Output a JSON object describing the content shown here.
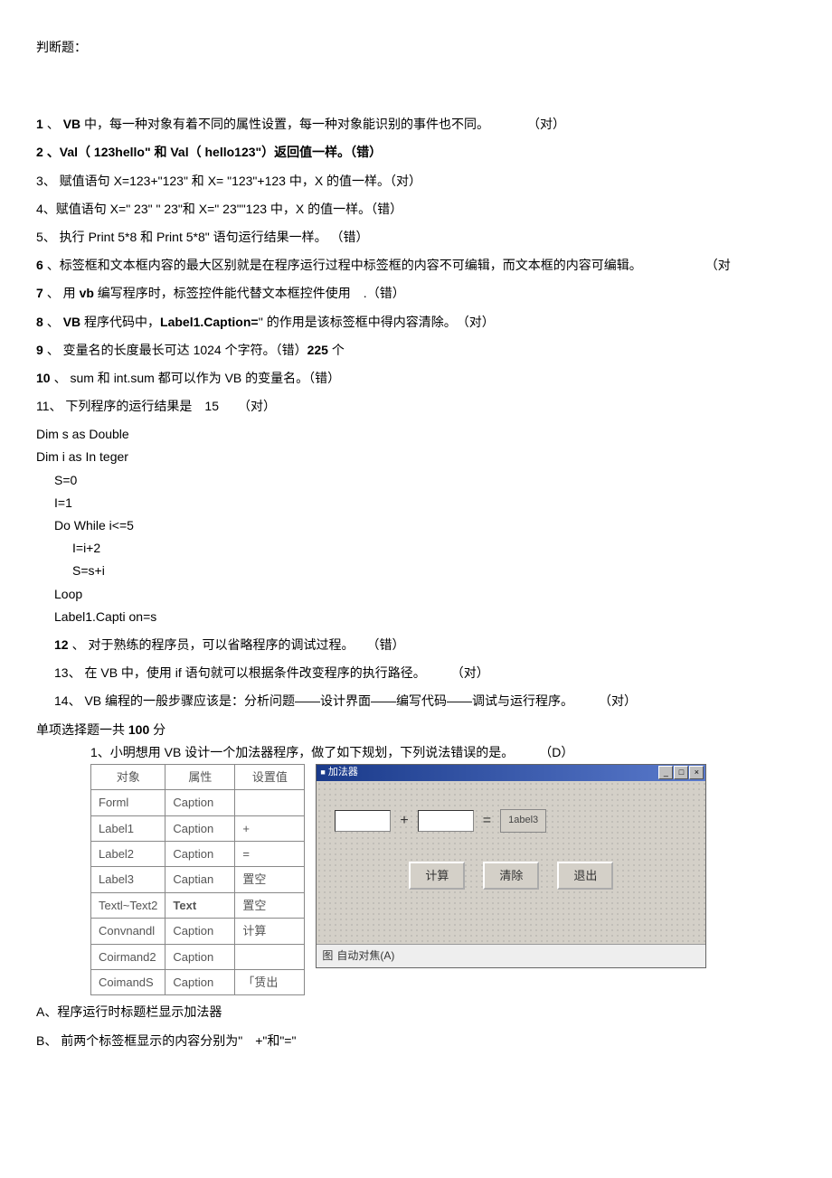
{
  "title": "判断题：",
  "questions": [
    {
      "num": "1",
      "prefix_bold": true,
      "text": "、 <b>VB</b> 中，每一种对象有着不同的属性设置，每一种对象能识别的事件也不同。　　　　（对）"
    },
    {
      "num": "2",
      "prefix_bold": true,
      "bold_all": true,
      "text": "、Val（ 123hello\" 和 Val（ hello123\"）返回值一样。（错）"
    },
    {
      "num": "3",
      "text": "、 赋值语句 X=123+\"123\" 和 X= \"123\"+123 中，X 的值一样。（对）"
    },
    {
      "num": "4",
      "text": "、赋值语句 X=\" 23\" \" 23\"和 X=\" 23\"\"123 中，X 的值一样。（错）"
    },
    {
      "num": "5",
      "text": "、 执行 Print 5*8 和 Print 5*8\" 语句运行结果一样。 （错）"
    },
    {
      "num": "6",
      "prefix_bold": true,
      "text": "、标签框和文本框内容的最大区别就是在程序运行过程中标签框的内容不可编辑，而文本框的内容可编辑。　　　　　　（对"
    },
    {
      "num": "7",
      "prefix_bold": true,
      "text": "、 用 <b>vb</b> 编写程序时，标签控件能代替文本框控件使用　.（错）"
    },
    {
      "num": "8",
      "prefix_bold": true,
      "text": "、 <b>VB</b> 程序代码中，<b>Label1.Caption=</b>'' 的作用是该标签框中得内容清除。　（对）"
    },
    {
      "num": "9",
      "prefix_bold": true,
      "text": "、 变量名的长度最长可达 1024 个字符。（错）<b>225</b> 个"
    },
    {
      "num": "10",
      "prefix_bold": true,
      "text": "、 sum 和 int.sum 都可以作为 VB 的变量名。（错）"
    },
    {
      "num": "11",
      "text": "、 下列程序的运行结果是　15　　（对）"
    }
  ],
  "code": [
    {
      "indent": 0,
      "text": "Dim s as Double"
    },
    {
      "indent": 0,
      "text": "Dim i as In teger"
    },
    {
      "indent": 1,
      "text": "S=0"
    },
    {
      "indent": 1,
      "text": "I=1"
    },
    {
      "indent": 1,
      "text": "Do While i<=5"
    },
    {
      "indent": 2,
      "text": "I=i+2"
    },
    {
      "indent": 2,
      "text": "S=s+i"
    },
    {
      "indent": 1,
      "text": "Loop"
    },
    {
      "indent": 1,
      "text": "Label1.Capti on=s"
    }
  ],
  "questions2": [
    {
      "num": "12",
      "prefix_bold": true,
      "text": "、 对于熟练的程序员，可以省略程序的调试过程。　　（错）"
    },
    {
      "num": "13",
      "text": "、 在 VB 中，使用 if 语句就可以根据条件改变程序的执行路径。　　　（对）"
    },
    {
      "num": "14",
      "text": "、 VB 编程的一般步骤应该是：分析问题——设计界面——编写代码——调试与运行程序。　　　（对）"
    }
  ],
  "mc_title_a": "单项选择题一共 ",
  "mc_title_b": "100",
  "mc_title_c": " 分",
  "mc_q1": "1、小明想用 VB 设计一个加法器程序，做了如下规划，下列说法错误的是。　　　（D）",
  "table": {
    "headers": [
      "对象",
      "属性",
      "设置值"
    ],
    "rows": [
      [
        "Forml",
        "Caption",
        ""
      ],
      [
        "Label1",
        "Caption",
        "+"
      ],
      [
        "Label2",
        "Caption",
        "="
      ],
      [
        "Label3",
        "Captian",
        "置空"
      ],
      [
        "Textl~Text2",
        "Text",
        "置空"
      ],
      [
        "Convnandl",
        "Caption",
        "计算"
      ],
      [
        "Coirmand2",
        "Caption",
        ""
      ],
      [
        "CoimandS",
        "Caption",
        "「赁出"
      ]
    ],
    "text_bold_row": 4
  },
  "vb": {
    "title": "加法器",
    "plus": "+",
    "equals": "=",
    "label3": "1abel3",
    "btn_calc": "计算",
    "btn_clear": "清除",
    "btn_exit": "退出",
    "footer_icon": "图",
    "footer": "自动对焦(A)"
  },
  "options": {
    "a": "A、程序运行时标题栏显示加法器",
    "b": "B、 前两个标签框显示的内容分别为\"　+\"和\"=\""
  }
}
